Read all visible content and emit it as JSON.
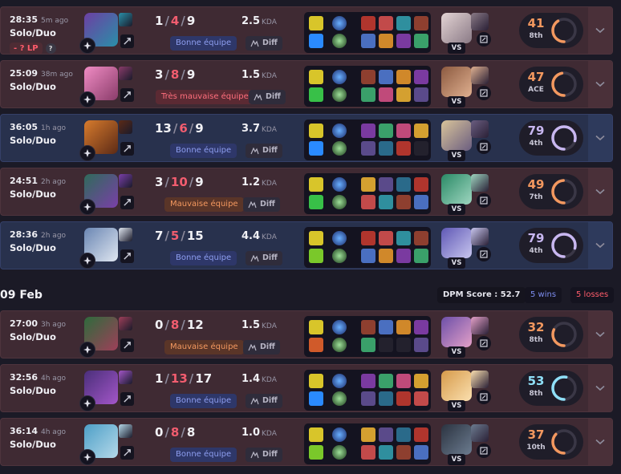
{
  "colors": {
    "loss_row": "#3f2a33",
    "win_row": "#28314d",
    "death_red": "#f25d6f",
    "accent_orange": "#f3985f",
    "accent_blue": "#7d8df0",
    "ring_blue": "#8fe0f8",
    "ring_purple": "#c8b7f0"
  },
  "matches": [
    {
      "duration": "28:35",
      "ago": "5m ago",
      "queue": "Solo/Duo",
      "lp": "- ? LP",
      "kills": "1",
      "deaths": "4",
      "assists": "9",
      "kda": "2.5",
      "kda_unit": "KDA",
      "team_badge": "Bonne équipe",
      "team_badge_style": "blue",
      "diff_label": "Diff",
      "vs": "VS",
      "score": "41",
      "rank": "8th",
      "score_color": "#f3985f",
      "score_fraction": 0.41,
      "result": "loss"
    },
    {
      "duration": "25:09",
      "ago": "38m ago",
      "queue": "Solo/Duo",
      "kills": "3",
      "deaths": "8",
      "assists": "9",
      "kda": "1.5",
      "kda_unit": "KDA",
      "team_badge": "Très mauvaise équipe",
      "team_badge_style": "red",
      "diff_label": "Diff",
      "vs": "VS",
      "score": "47",
      "rank": "ACE",
      "score_color": "#f3985f",
      "score_fraction": 0.47,
      "result": "loss"
    },
    {
      "duration": "36:05",
      "ago": "1h ago",
      "queue": "Solo/Duo",
      "kills": "13",
      "deaths": "6",
      "assists": "9",
      "kda": "3.7",
      "kda_unit": "KDA",
      "team_badge": "Bonne équipe",
      "team_badge_style": "blue",
      "diff_label": "Diff",
      "vs": "VS",
      "score": "79",
      "rank": "4th",
      "score_color": "#c8b7f0",
      "score_fraction": 0.79,
      "result": "win"
    },
    {
      "duration": "24:51",
      "ago": "2h ago",
      "queue": "Solo/Duo",
      "kills": "3",
      "deaths": "10",
      "assists": "9",
      "kda": "1.2",
      "kda_unit": "KDA",
      "team_badge": "Mauvaise équipe",
      "team_badge_style": "orange",
      "diff_label": "Diff",
      "vs": "VS",
      "score": "49",
      "rank": "7th",
      "score_color": "#f3985f",
      "score_fraction": 0.49,
      "result": "loss"
    },
    {
      "duration": "28:36",
      "ago": "2h ago",
      "queue": "Solo/Duo",
      "kills": "7",
      "deaths": "5",
      "assists": "15",
      "kda": "4.4",
      "kda_unit": "KDA",
      "team_badge": "Bonne équipe",
      "team_badge_style": "blue",
      "diff_label": "Diff",
      "vs": "VS",
      "score": "79",
      "rank": "4th",
      "score_color": "#c8b7f0",
      "score_fraction": 0.79,
      "result": "win"
    },
    {
      "duration": "27:00",
      "ago": "3h ago",
      "queue": "Solo/Duo",
      "kills": "0",
      "deaths": "8",
      "assists": "12",
      "kda": "1.5",
      "kda_unit": "KDA",
      "team_badge": "Mauvaise équipe",
      "team_badge_style": "orange",
      "diff_label": "Diff",
      "vs": "VS",
      "score": "32",
      "rank": "8th",
      "score_color": "#f3985f",
      "score_fraction": 0.32,
      "result": "loss"
    },
    {
      "duration": "32:56",
      "ago": "4h ago",
      "queue": "Solo/Duo",
      "kills": "1",
      "deaths": "13",
      "assists": "17",
      "kda": "1.4",
      "kda_unit": "KDA",
      "team_badge": "Bonne équipe",
      "team_badge_style": "blue",
      "diff_label": "Diff",
      "vs": "VS",
      "score": "53",
      "rank": "8th",
      "score_color": "#8fe0f8",
      "score_fraction": 0.53,
      "result": "loss"
    },
    {
      "duration": "36:14",
      "ago": "4h ago",
      "queue": "Solo/Duo",
      "kills": "0",
      "deaths": "8",
      "assists": "8",
      "kda": "1.0",
      "kda_unit": "KDA",
      "team_badge": "Bonne équipe",
      "team_badge_style": "blue",
      "diff_label": "Diff",
      "vs": "VS",
      "score": "37",
      "rank": "10th",
      "score_color": "#f3985f",
      "score_fraction": 0.37,
      "result": "loss"
    }
  ],
  "date_header": {
    "date": "09 Feb",
    "dpm": "DPM Score : 52.7",
    "wins": "5 wins",
    "losses": "5 losses"
  }
}
